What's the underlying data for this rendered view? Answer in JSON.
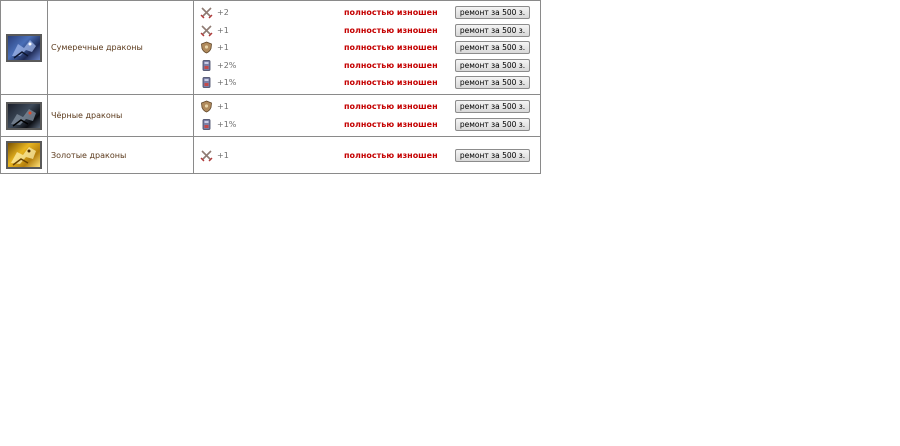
{
  "colors": {
    "unit_name": "#5b3a1c",
    "status": "#c40000",
    "bonus": "#6e6e6e",
    "border": "#8a8a8a"
  },
  "units": [
    {
      "name": "Сумеречные драконы",
      "portrait": "twilight-dragon-portrait",
      "artifacts": [
        {
          "icon": "crossed-swords-icon",
          "bonus": "+2",
          "status": "полностью изношен",
          "repair_label": "ремонт за 500 з."
        },
        {
          "icon": "crossed-swords-icon",
          "bonus": "+1",
          "status": "полностью изношен",
          "repair_label": "ремонт за 500 з."
        },
        {
          "icon": "shield-icon",
          "bonus": "+1",
          "status": "полностью изношен",
          "repair_label": "ремонт за 500 з."
        },
        {
          "icon": "scroll-icon",
          "bonus": "+2%",
          "status": "полностью изношен",
          "repair_label": "ремонт за 500 з."
        },
        {
          "icon": "scroll-icon",
          "bonus": "+1%",
          "status": "полностью изношен",
          "repair_label": "ремонт за 500 з."
        }
      ]
    },
    {
      "name": "Чёрные драконы",
      "portrait": "black-dragon-portrait",
      "artifacts": [
        {
          "icon": "shield-icon",
          "bonus": "+1",
          "status": "полностью изношен",
          "repair_label": "ремонт за 500 з."
        },
        {
          "icon": "scroll-icon",
          "bonus": "+1%",
          "status": "полностью изношен",
          "repair_label": "ремонт за 500 з."
        }
      ]
    },
    {
      "name": "Золотые драконы",
      "portrait": "gold-dragon-portrait",
      "artifacts": [
        {
          "icon": "crossed-swords-icon",
          "bonus": "+1",
          "status": "полностью изношен",
          "repair_label": "ремонт за 500 з."
        }
      ]
    }
  ]
}
